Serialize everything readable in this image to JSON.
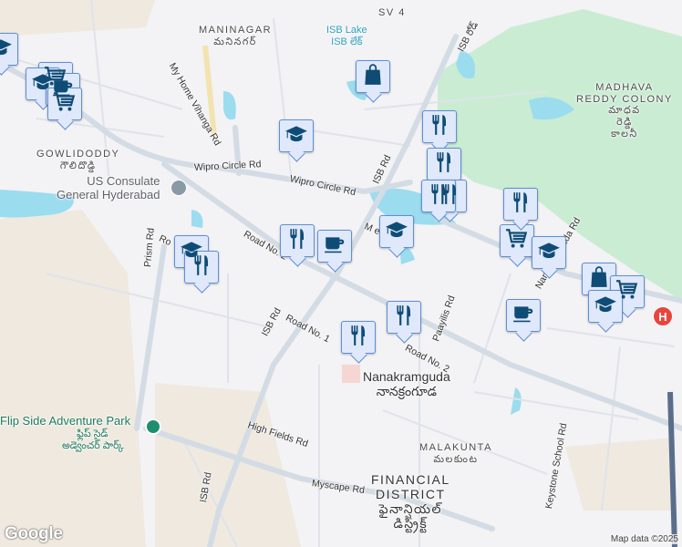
{
  "labels": {
    "maninagar": "MANINAGAR",
    "maninagar_te": "మనినగర్",
    "sv4": "SV 4",
    "isb_lake": "ISB Lake",
    "isb_lake_te": "ISB లేక్",
    "isb_road_te": "ISB రోడ్",
    "madhava": "MADHAVA",
    "reddy_colony": "REDDY COLONY",
    "madhava_te": "మాధవ",
    "reddy_te": "రెడ్డి",
    "colony_te": "కాలనీ",
    "gowlidoddy": "GOWLIDODDY",
    "gowlidoddy_te": "గౌలిదొడ్డి",
    "us_consulate_1": "US Consulate",
    "us_consulate_2": "General Hyderabad",
    "nanakramguda": "Nanakramguda",
    "nanakramguda_te": "నానక్రంగూడ",
    "flipside": "Flip Side Adventure Park",
    "flipside_te_1": "ఫ్లిప్ సైడ్",
    "flipside_te_2": "అడ్వెంచర్ పార్క్",
    "malakunta": "MALAKUNTA",
    "malakunta_te": "మలకుంట",
    "financial": "FINANCIAL",
    "district": "DISTRICT",
    "financial_te_1": "ఫైనాన్షియల్",
    "financial_te_2": "డిస్ట్రిక్ట్"
  },
  "roads": {
    "my_home_vihanga": "My Home Vihanga Rd",
    "wipro_circle_1": "Wipro Circle Rd",
    "wipro_circle_2": "Wipro Circle Rd",
    "isb_rd_1": "ISB Rd",
    "isb_rd_2": "ISB Rd",
    "isb_rd_3": "ISB Rd",
    "prism": "Prism Rd",
    "road_no2_a": "Road No. 2",
    "road_no2_b": "Ro",
    "road_no1": "Road No. 1",
    "road_no2_c": "Road No. 2",
    "westia": "M  estia Rd",
    "nanakramguda_rd": "Nanakramguda Rd",
    "paayilis": "Paayilis Rd",
    "high_fields": "High Fields Rd",
    "myscape": "Myscape Rd",
    "keystone": "Keystone School Rd"
  },
  "hospital_icon": "H",
  "attribution": "Map data ©2025",
  "logo": "Google",
  "colors": {
    "water": "#9bdcef",
    "park": "#c9ecd3",
    "road": "#d3dce4",
    "pin_fill": "#dfe9fb",
    "pin_border": "#5f8ed6",
    "icon": "#0f4c75"
  },
  "markers": [
    "school",
    "shopping-cart",
    "school",
    "cafe",
    "shopping-cart",
    "shopping-bag",
    "school",
    "restaurant",
    "restaurant",
    "restaurant",
    "restaurant",
    "school",
    "restaurant",
    "cafe",
    "school",
    "restaurant",
    "restaurant",
    "shopping-cart",
    "school",
    "shopping-bag",
    "shopping-cart",
    "school",
    "cafe",
    "restaurant",
    "restaurant"
  ]
}
